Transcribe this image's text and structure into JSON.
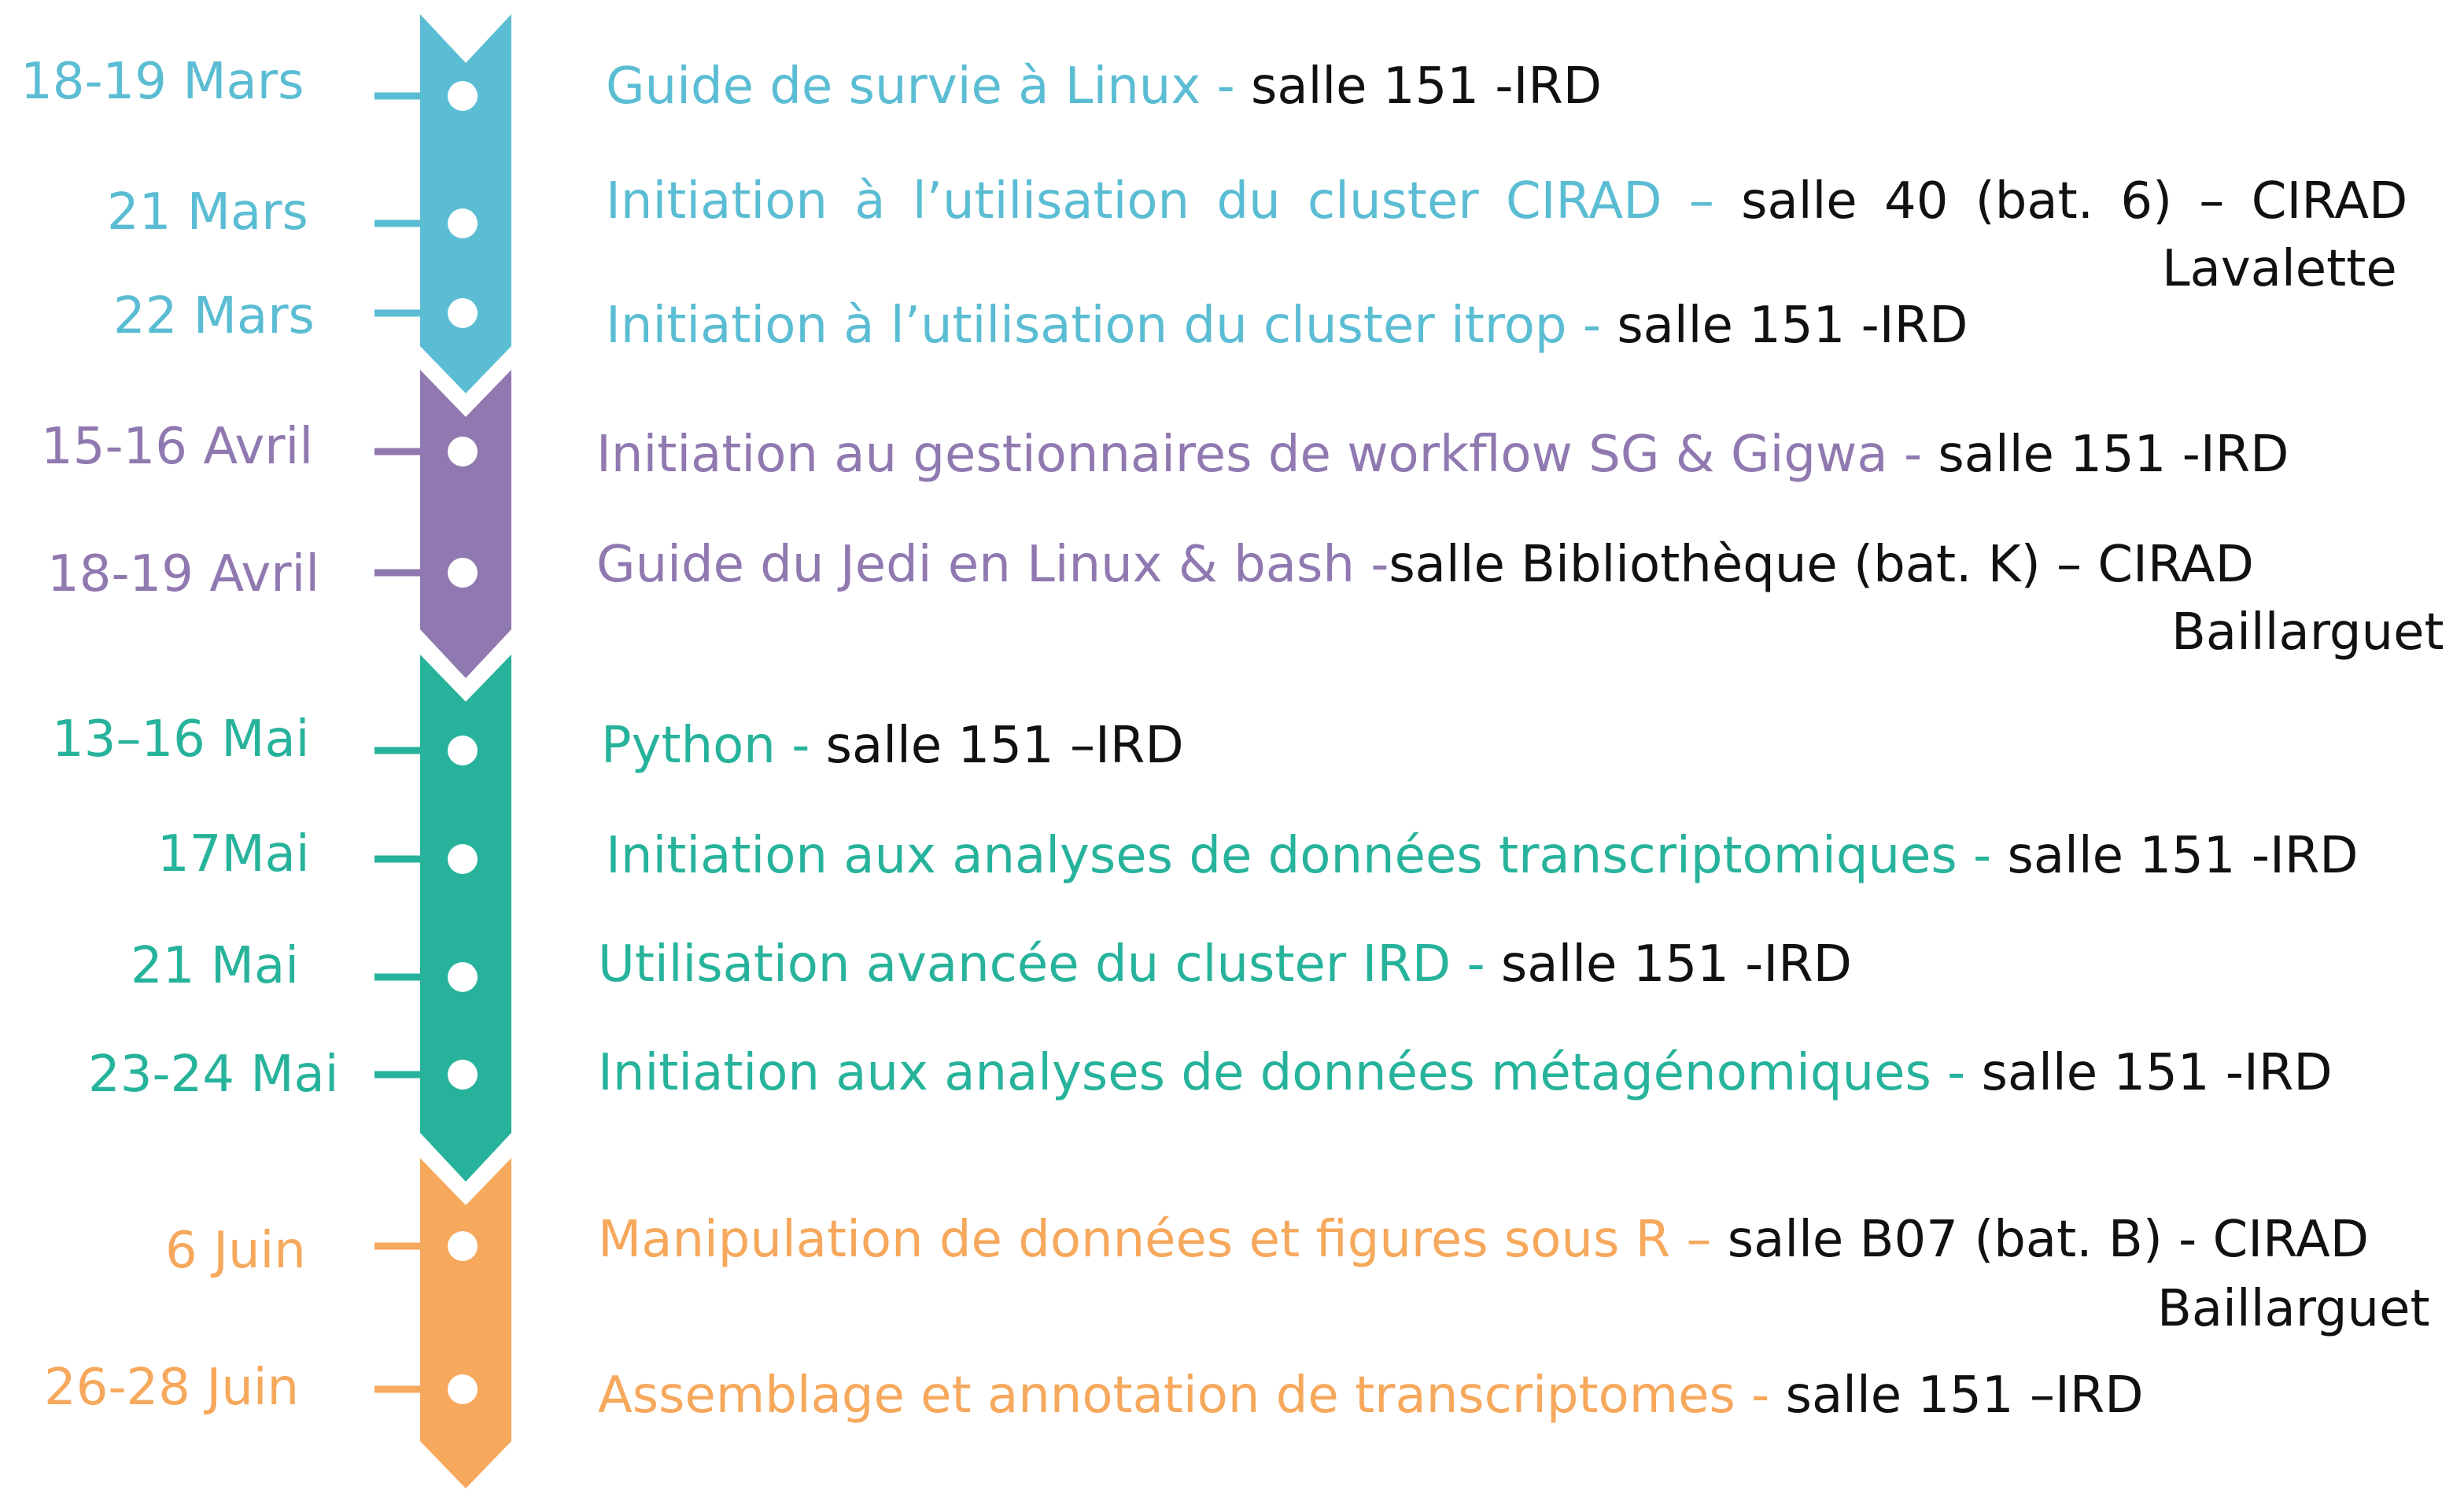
{
  "colors": {
    "march": "#5bbdd3",
    "april": "#9079b0",
    "may": "#27b39b",
    "june": "#f6a85c",
    "location_text": "#111111",
    "dot": "#ffffff"
  },
  "months": [
    {
      "key": "march",
      "color": "#5bbdd3"
    },
    {
      "key": "april",
      "color": "#9079b0"
    },
    {
      "key": "may",
      "color": "#27b39b"
    },
    {
      "key": "june",
      "color": "#f6a85c"
    }
  ],
  "events": [
    {
      "date": "18-19 Mars",
      "title": "Guide de survie à Linux",
      "sep": " - ",
      "location": "salle 151 -IRD",
      "continuation": ""
    },
    {
      "date": "21 Mars",
      "title": "Initiation à l’utilisation du cluster CIRAD",
      "sep": " – ",
      "location": "salle 40 (bat. 6) – CIRAD",
      "continuation": "Lavalette"
    },
    {
      "date": "22 Mars",
      "title": "Initiation à l’utilisation du cluster itrop",
      "sep": " - ",
      "location": "salle 151 -IRD",
      "continuation": ""
    },
    {
      "date": "15-16 Avril",
      "title": "Initiation au gestionnaires de workflow SG & Gigwa",
      "sep": " - ",
      "location": "salle 151 -IRD",
      "continuation": ""
    },
    {
      "date": "18-19 Avril",
      "title": "Guide du Jedi en Linux & bash",
      "sep": " -",
      "location": "salle Bibliothèque (bat. K) – CIRAD",
      "continuation": "Baillarguet"
    },
    {
      "date": "13–16 Mai",
      "title": "Python",
      "sep": " - ",
      "location": "salle 151 –IRD",
      "continuation": ""
    },
    {
      "date": "17Mai",
      "title": "Initiation aux analyses de données transcriptomiques",
      "sep": " - ",
      "location": "salle 151 -IRD",
      "continuation": ""
    },
    {
      "date": "21 Mai",
      "title": "Utilisation avancée du cluster IRD",
      "sep": " - ",
      "location": "salle 151 -IRD",
      "continuation": ""
    },
    {
      "date": "23-24 Mai",
      "title": "Initiation aux analyses de données métagénomiques",
      "sep": " - ",
      "location": "salle 151 -IRD",
      "continuation": ""
    },
    {
      "date": "6 Juin",
      "title": "Manipulation de données et figures sous R",
      "sep": " – ",
      "location": "salle B07 (bat. B) - CIRAD",
      "continuation": "Baillarguet"
    },
    {
      "date": "26-28 Juin",
      "title": "Assemblage et annotation de transcriptomes",
      "sep": " - ",
      "location": "salle 151 –IRD",
      "continuation": ""
    }
  ]
}
